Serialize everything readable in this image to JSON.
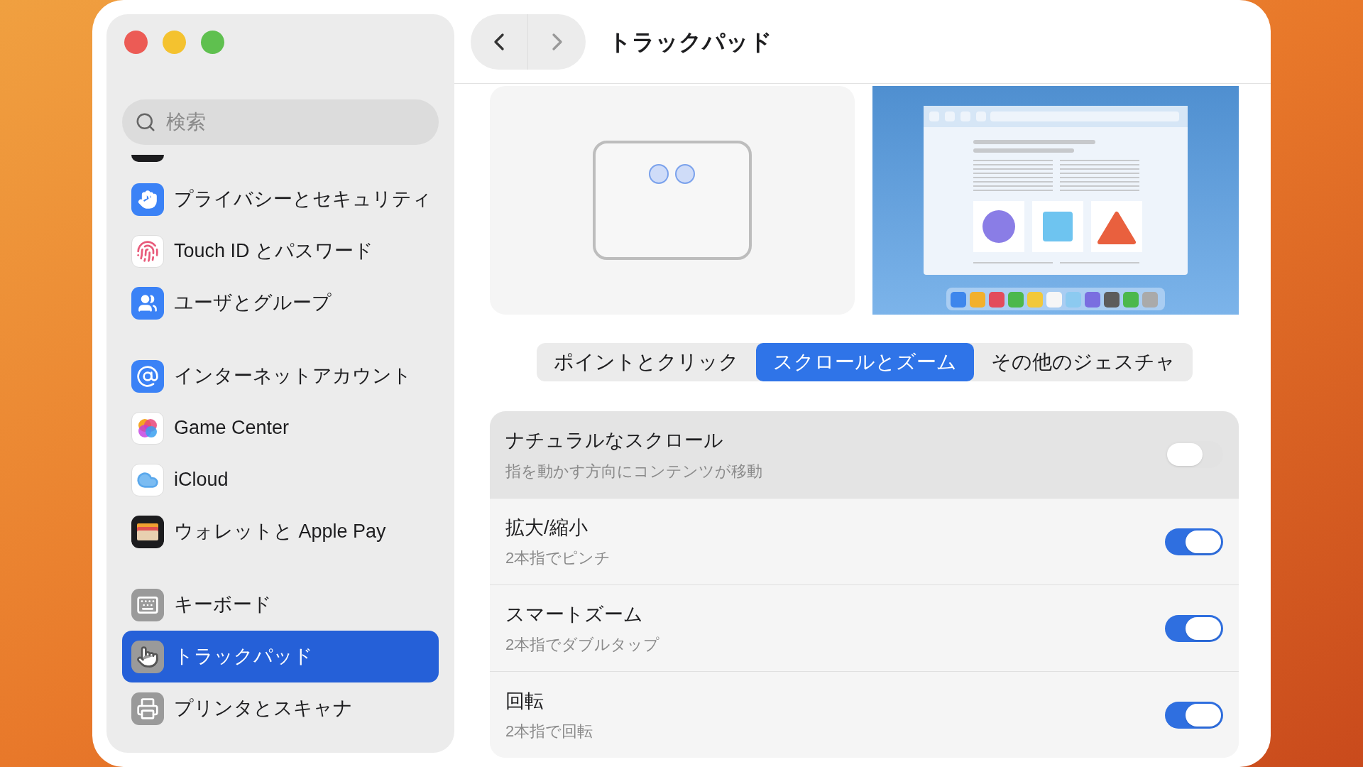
{
  "window": {
    "title": "トラックパッド"
  },
  "sidebar": {
    "search": {
      "placeholder": "検索"
    },
    "groups": [
      [
        {
          "label": "プライバシーとセキュリティ",
          "selected": false
        },
        {
          "label": "Touch ID とパスワード",
          "selected": false
        },
        {
          "label": "ユーザとグループ",
          "selected": false
        }
      ],
      [
        {
          "label": "インターネットアカウント",
          "selected": false
        },
        {
          "label": "Game Center",
          "selected": false
        },
        {
          "label": "iCloud",
          "selected": false
        },
        {
          "label": "ウォレットと Apple Pay",
          "selected": false
        }
      ],
      [
        {
          "label": "キーボード",
          "selected": false
        },
        {
          "label": "トラックパッド",
          "selected": true
        },
        {
          "label": "プリンタとスキャナ",
          "selected": false
        }
      ]
    ]
  },
  "tabs": [
    {
      "label": "ポイントとクリック",
      "selected": false
    },
    {
      "label": "スクロールとズーム",
      "selected": true
    },
    {
      "label": "その他のジェスチャ",
      "selected": false
    }
  ],
  "settings": [
    {
      "title": "ナチュラルなスクロール",
      "subtitle": "指を動かす方向にコンテンツが移動",
      "on": false,
      "selected": true
    },
    {
      "title": "拡大/縮小",
      "subtitle": "2本指でピンチ",
      "on": true,
      "selected": false
    },
    {
      "title": "スマートズーム",
      "subtitle": "2本指でダブルタップ",
      "on": true,
      "selected": false
    },
    {
      "title": "回転",
      "subtitle": "2本指で回転",
      "on": true,
      "selected": false
    }
  ]
}
